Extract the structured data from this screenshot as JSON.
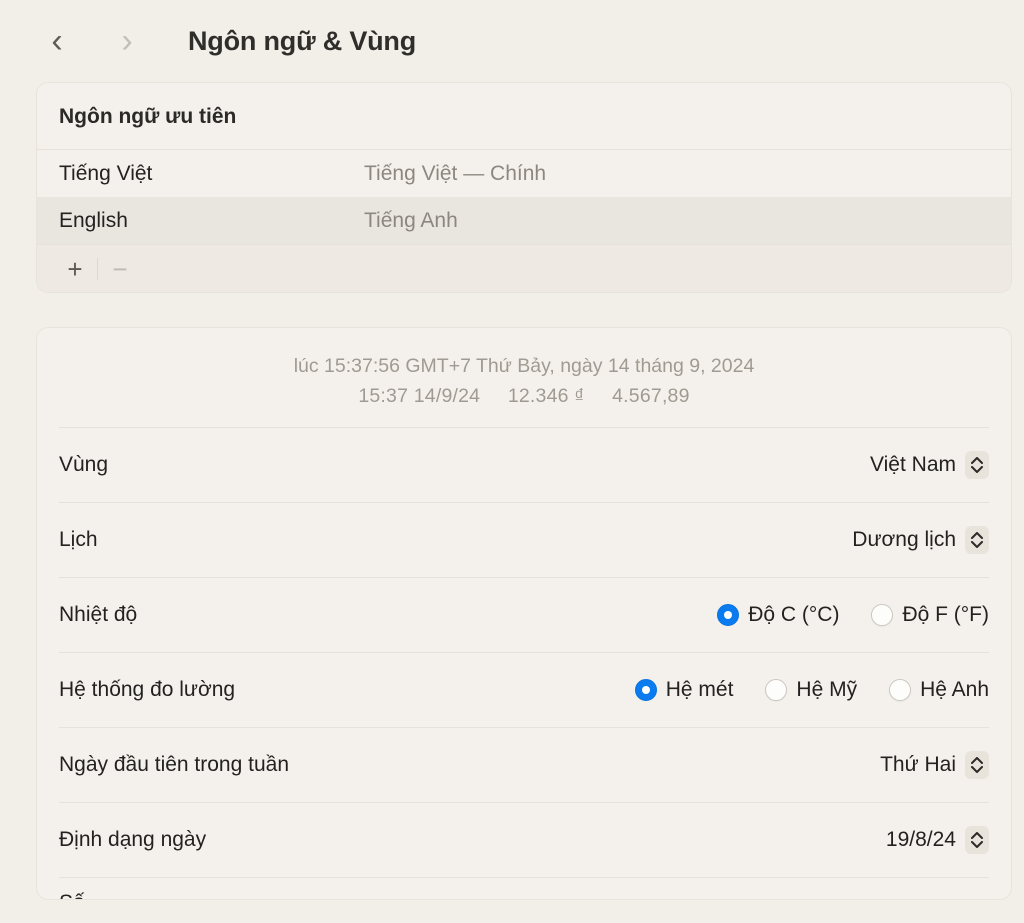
{
  "header": {
    "back_icon": "chevron-left-icon",
    "forward_icon": "chevron-right-icon",
    "title": "Ngôn ngữ & Vùng"
  },
  "languages_card": {
    "heading": "Ngôn ngữ ưu tiên",
    "rows": [
      {
        "name": "Tiếng Việt",
        "description": "Tiếng Việt — Chính",
        "selected": false
      },
      {
        "name": "English",
        "description": "Tiếng Anh",
        "selected": true
      }
    ],
    "footer": {
      "add_label": "+",
      "remove_label": "−"
    }
  },
  "region_card": {
    "preview": {
      "line1": "lúc 15:37:56 GMT+7 Thứ Bảy, ngày 14 tháng 9, 2024",
      "line2_time": "15:37 14/9/24",
      "line2_currency": "12.346 ₫",
      "line2_number": "4.567,89"
    },
    "rows": {
      "region": {
        "label": "Vùng",
        "value": "Việt Nam"
      },
      "calendar": {
        "label": "Lịch",
        "value": "Dương lịch"
      },
      "temperature": {
        "label": "Nhiệt độ",
        "options": [
          {
            "label": "Độ C (°C)",
            "selected": true
          },
          {
            "label": "Độ F (°F)",
            "selected": false
          }
        ]
      },
      "measurement": {
        "label": "Hệ thống đo lường",
        "options": [
          {
            "label": "Hệ mét",
            "selected": true
          },
          {
            "label": "Hệ Mỹ",
            "selected": false
          },
          {
            "label": "Hệ Anh",
            "selected": false
          }
        ]
      },
      "first_day": {
        "label": "Ngày đầu tiên trong tuần",
        "value": "Thứ Hai"
      },
      "date_format": {
        "label": "Định dạng ngày",
        "value": "19/8/24"
      },
      "cut_off": {
        "label": "Số"
      }
    }
  },
  "colors": {
    "accent_blue": "#0a7cf0",
    "page_background": "#f2efe9",
    "card_background": "#f4f1ec",
    "row_selected_background": "#e9e5df",
    "secondary_text": "#8c8880"
  }
}
